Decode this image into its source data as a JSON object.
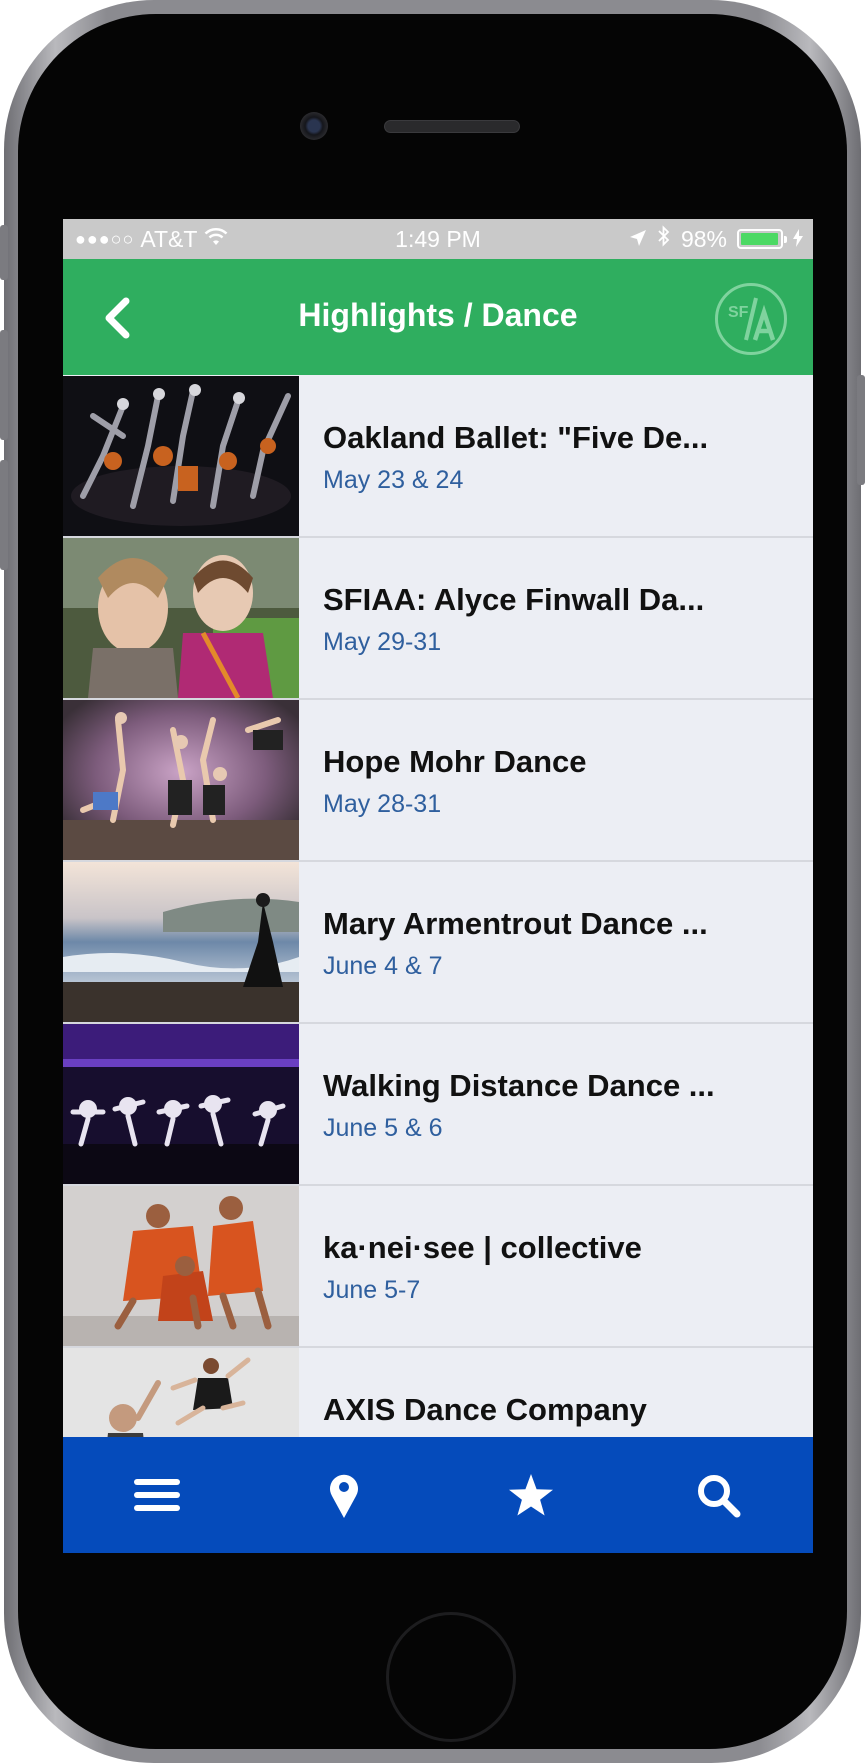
{
  "status_bar": {
    "signal": "●●●○○",
    "carrier": "AT&T",
    "time": "1:49 PM",
    "battery_percent": "98%",
    "battery_level": 0.98
  },
  "nav": {
    "title": "Highlights / Dance",
    "logo_text": "SF/A"
  },
  "events": [
    {
      "title": "Oakland Ballet: \"Five De...",
      "date": "May 23 & 24"
    },
    {
      "title": "SFIAA: Alyce Finwall Da...",
      "date": "May 29-31"
    },
    {
      "title": "Hope Mohr Dance",
      "date": "May 28-31"
    },
    {
      "title": "Mary Armentrout Dance ...",
      "date": "June 4 & 7"
    },
    {
      "title": "Walking Distance Dance ...",
      "date": "June 5 & 6"
    },
    {
      "title": "ka·nei·see | collective",
      "date": "June 5-7"
    },
    {
      "title": "AXIS Dance Company",
      "date": ""
    }
  ],
  "tab_bar": {
    "icons": [
      "menu-icon",
      "location-pin-icon",
      "star-icon",
      "search-icon"
    ]
  },
  "colors": {
    "nav_green": "#2fae5f",
    "tab_blue": "#054bbb",
    "date_blue": "#2f5f9e",
    "row_bg": "#eceef4"
  }
}
